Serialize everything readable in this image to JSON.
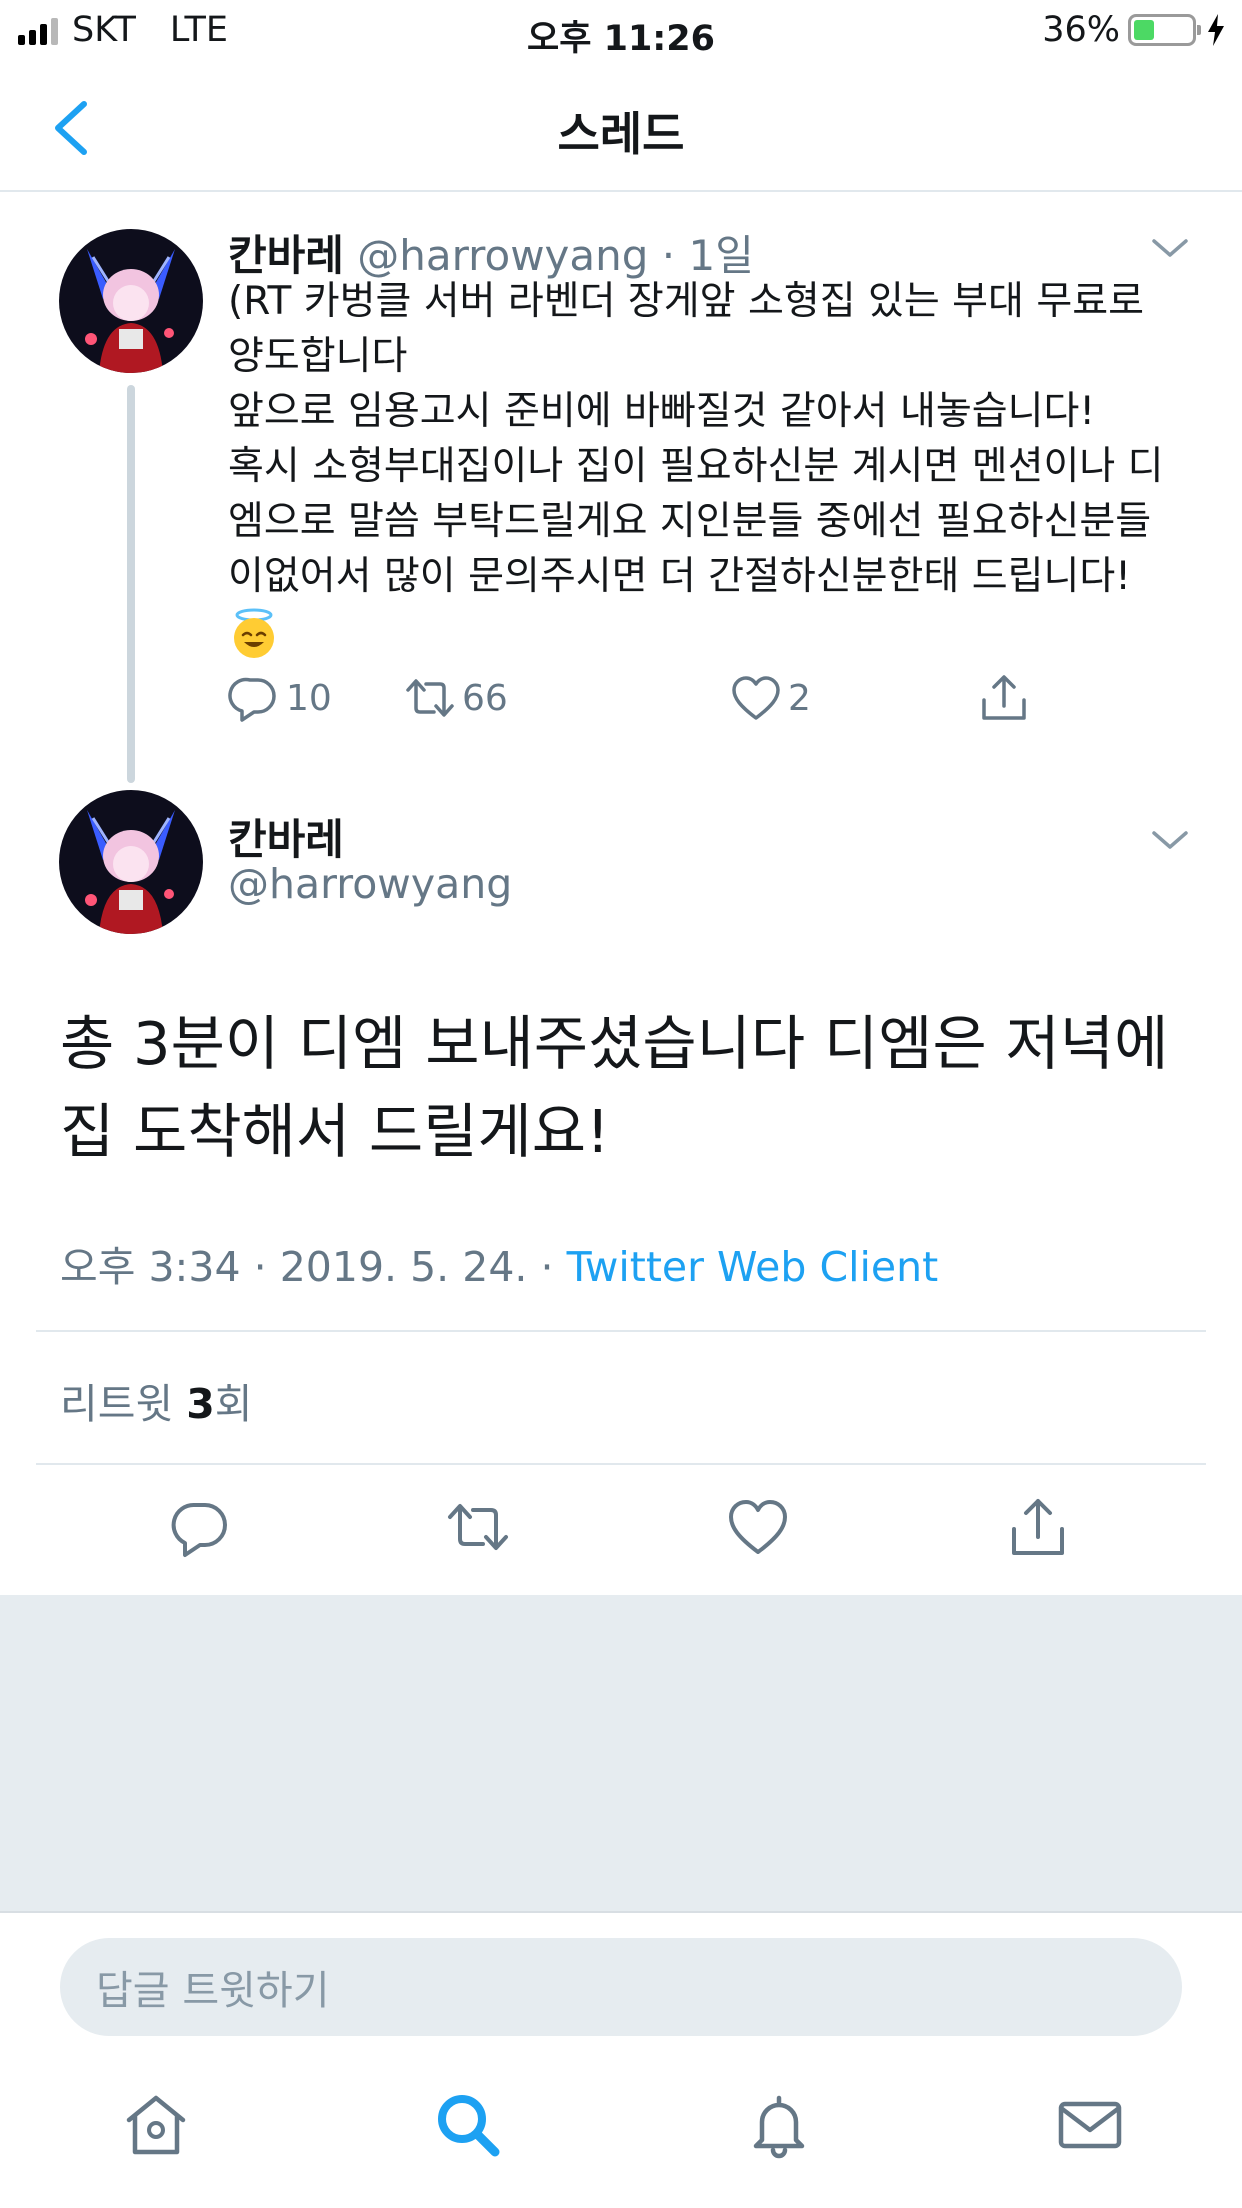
{
  "status_bar": {
    "carrier": "SKT",
    "network": "LTE",
    "time": "오후 11:26",
    "battery_percent": "36%",
    "battery_level": 0.36,
    "battery_color": "#4cd964"
  },
  "nav": {
    "back_icon": "chevron-left-icon",
    "title": "스레드"
  },
  "parent_tweet": {
    "display_name": "칸바레",
    "handle": "@harrowyang",
    "separator": "·",
    "relative_time": "1일",
    "lines": [
      "(RT 카벙클 서버 라벤더 장게앞 소형집 있는 부대 무료로",
      "양도합니다",
      "앞으로 임용고시 준비에 바빠질것 같아서 내놓습니다!",
      "혹시 소형부대집이나 집이 필요하신분 계시면 멘션이나 디",
      "엠으로 말씀 부탁드릴게요 지인분들 중에선 필요하신분들",
      "이없어서 많이 문의주시면 더 간절하신분한태 드립니다!"
    ],
    "emoji": "smiling-face-with-halo-emoji",
    "reply_count": "10",
    "retweet_count": "66",
    "like_count": "2"
  },
  "main_tweet": {
    "display_name": "칸바레",
    "handle": "@harrowyang",
    "text_lines": [
      "총 3분이 디엠 보내주셨습니다 디엠은 저녁에",
      "집 도착해서 드릴게요!"
    ],
    "time": "오후 3:34",
    "separator1": "·",
    "date": "2019. 5. 24.",
    "separator2": "·",
    "client": "Twitter Web Client",
    "retweets_label_prefix": "리트윗",
    "retweets_count": "3",
    "retweets_label_suffix": "회"
  },
  "reply_composer": {
    "placeholder": "답글 트윗하기"
  },
  "tab_bar": {
    "items": [
      "home-icon",
      "search-icon",
      "notifications-icon",
      "messages-icon"
    ],
    "active": "search-icon"
  },
  "colors": {
    "accent": "#1da1f2",
    "secondary_text": "#657786",
    "divider": "#e1e8ed",
    "background_gray": "#e6ecf0"
  }
}
